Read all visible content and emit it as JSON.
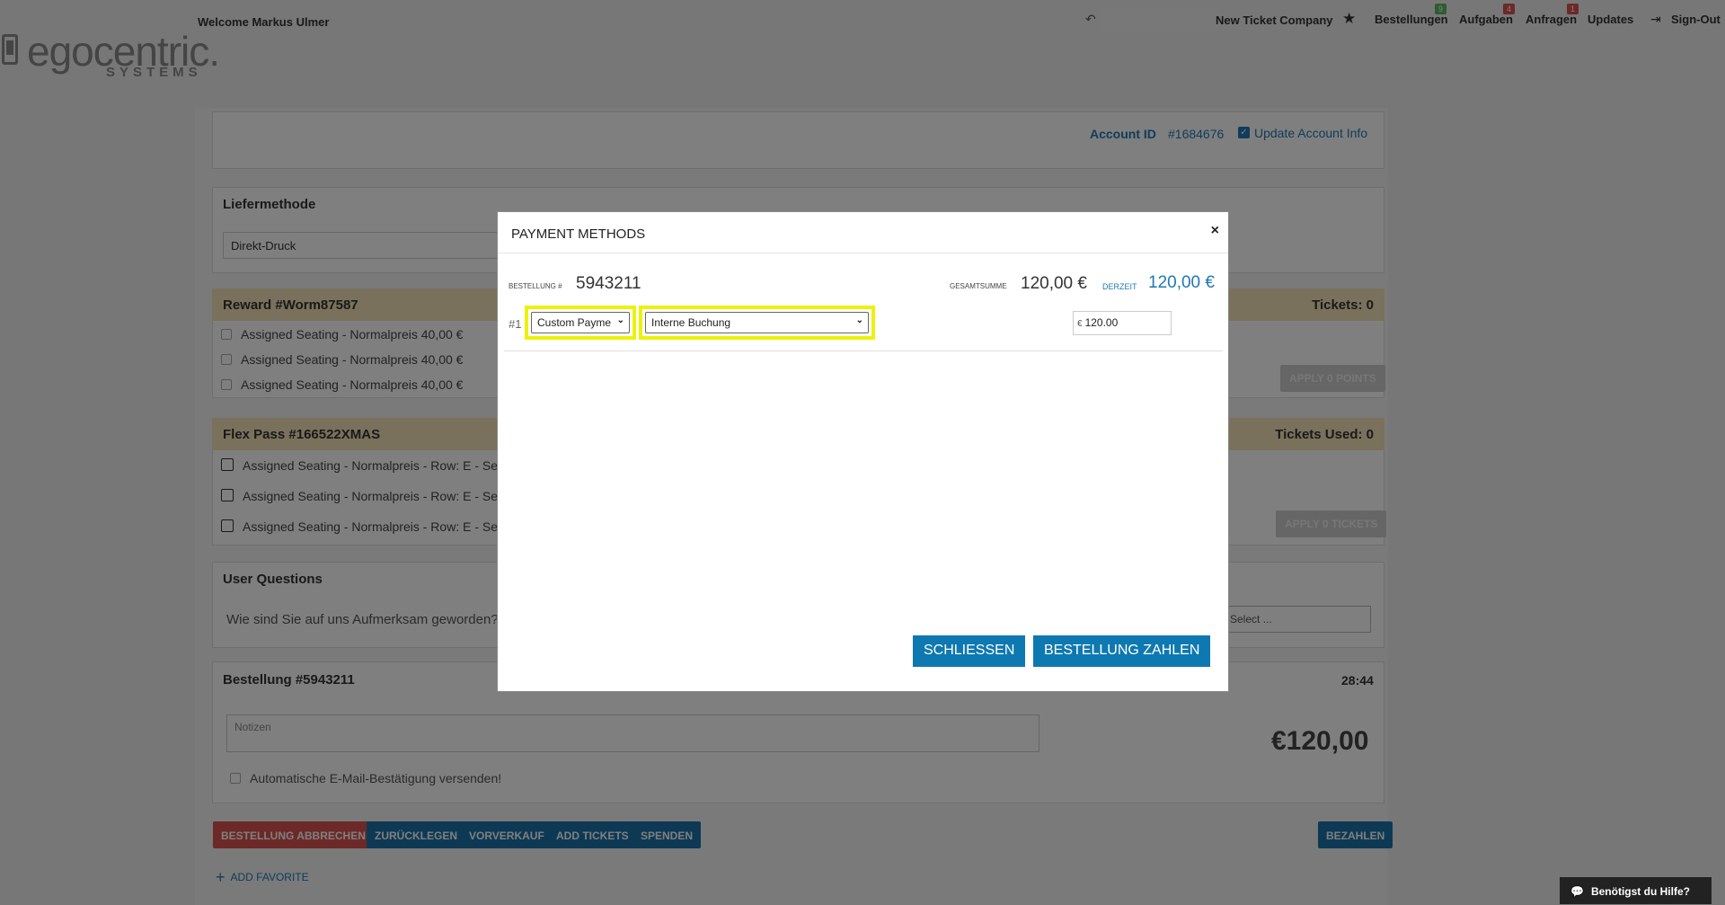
{
  "header": {
    "logo_brand": "egocentric.",
    "logo_sub": "SYSTEMS",
    "welcome": "Welcome Markus Ulmer",
    "company": "New Ticket Company",
    "nav": [
      {
        "label": "Bestellungen",
        "badge": "9"
      },
      {
        "label": "Aufgaben",
        "badge": "4"
      },
      {
        "label": "Anfragen",
        "badge": "1"
      },
      {
        "label": "Updates",
        "badge": ""
      },
      {
        "label": "Sign-Out",
        "badge": ""
      }
    ]
  },
  "account": {
    "label": "Account ID",
    "id": "#1684676",
    "update_label": "Update Account Info"
  },
  "delivery": {
    "title": "Liefermethode",
    "value": "Direkt-Druck"
  },
  "reward": {
    "title": "Reward #Worm87587",
    "tickets": "Tickets: 0",
    "items": [
      "Assigned Seating - Normalpreis 40,00 €",
      "Assigned Seating - Normalpreis 40,00 €",
      "Assigned Seating - Normalpreis 40,00 €"
    ],
    "apply_label": "APPLY 0 POINTS"
  },
  "flexpass": {
    "title": "Flex Pass #166522XMAS",
    "tickets": "Tickets Used: 0",
    "items": [
      "Assigned Seating - Normalpreis - Row: E - Se",
      "Assigned Seating - Normalpreis - Row: E - Se",
      "Assigned Seating - Normalpreis - Row: E - Se"
    ],
    "apply_label": "APPLY 0 TICKETS"
  },
  "questions": {
    "title": "User Questions",
    "question": "Wie sind Sie auf uns Aufmerksam geworden?",
    "select_value": "e Select ..."
  },
  "order": {
    "title": "Bestellung #5943211",
    "timer": "28:44",
    "notes_placeholder": "Notizen",
    "email_label": "Automatische E-Mail-Bestätigung versenden!",
    "total": "€120,00"
  },
  "actions": {
    "cancel": "BESTELLUNG ABBRECHEN",
    "reserve": "ZURÜCKLEGEN",
    "presale": "VORVERKAUF",
    "add_tickets": "ADD TICKETS",
    "donate": "SPENDEN",
    "pay": "BEZAHLEN",
    "add_favorite": "ADD FAVORITE"
  },
  "modal": {
    "title": "PAYMENT METHODS",
    "close": "×",
    "order_label": "BESTELLUNG #",
    "order_number": "5943211",
    "sum_label": "GESAMTSUMME",
    "sum_value": "120,00 €",
    "current_label": "DERZEIT",
    "current_value": "120,00 €",
    "row_number": "#1",
    "method_type": "Custom Payme",
    "method_value": "Interne Buchung",
    "currency": "€",
    "amount": "120.00",
    "close_button": "SCHLIESSEN",
    "pay_button": "BESTELLUNG ZAHLEN"
  },
  "help": {
    "label": "Benötigst du Hilfe?"
  },
  "colors": {
    "accent_blue": "#0e78b0",
    "highlight": "#ecf20a",
    "danger": "#d9534f",
    "reward_bg": "#f5e3b8"
  }
}
